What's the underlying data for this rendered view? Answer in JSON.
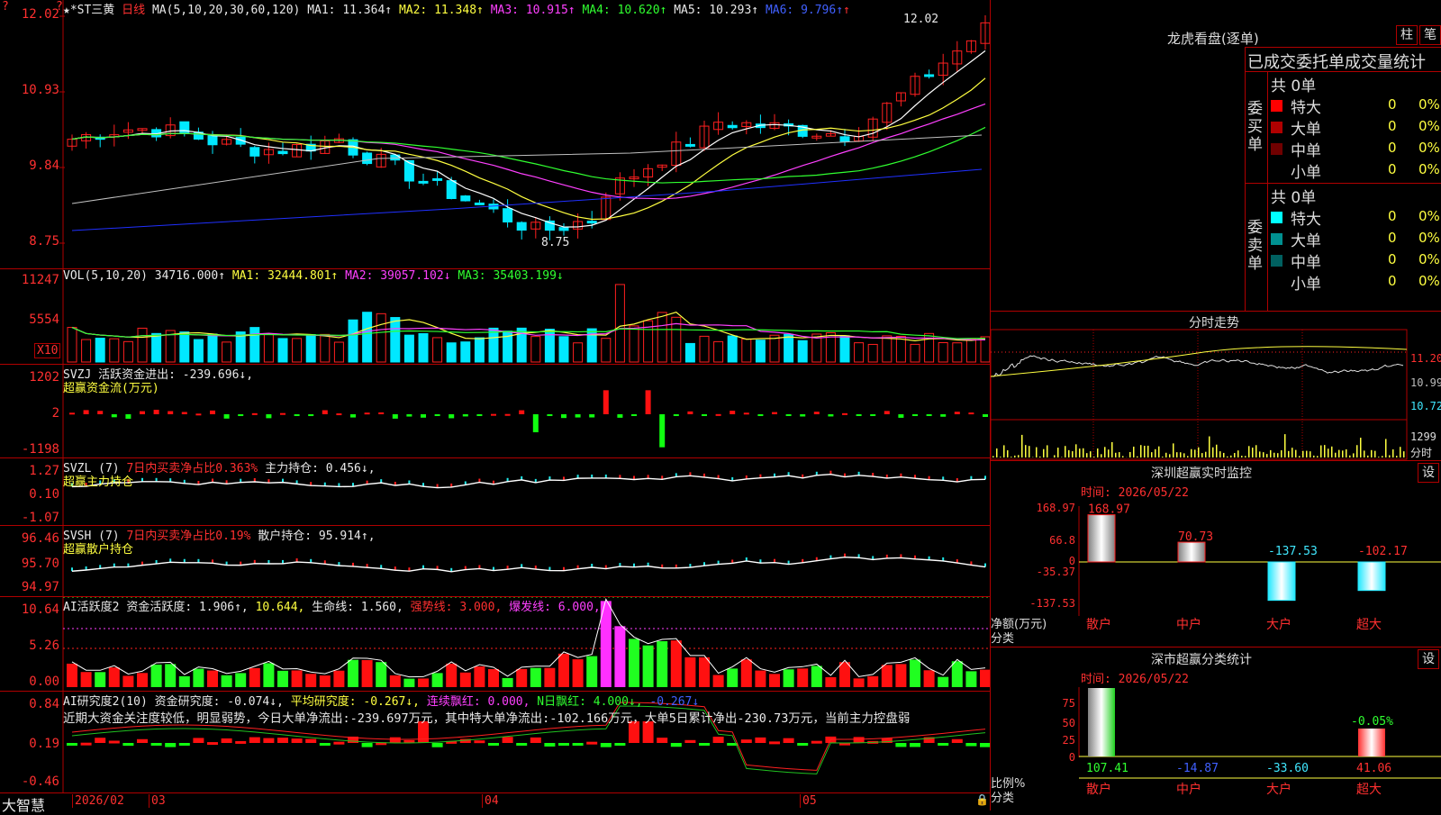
{
  "stock": {
    "name": "★*ST三黄",
    "period": "日线",
    "ma_header": {
      "label": "MA(5,10,20,30,60,120)",
      "ma1": "MA1: 11.364↑",
      "ma2": "MA2: 11.348↑",
      "ma3": "MA3: 10.915↑",
      "ma4": "MA4: 10.620↑",
      "ma5": "MA5: 10.293↑",
      "ma6": "MA6: 9.796↑"
    },
    "price_axis": [
      "12.02",
      "10.93",
      "9.84",
      "8.75"
    ],
    "high_label": "12.02",
    "low_label": "8.75"
  },
  "vol": {
    "header": {
      "label": "VOL(5,10,20)",
      "value": "34716.000↑",
      "ma1": "MA1: 32444.801↑",
      "ma2": "MA2: 39057.102↓",
      "ma3": "MA3: 35403.199↓"
    },
    "axis": [
      "11247",
      "5554"
    ],
    "unit": "X10"
  },
  "svzj": {
    "header": {
      "label": "SVZJ",
      "value": "活跃资金进出: -239.696↓,",
      "sub": "超赢资金流(万元)"
    },
    "axis": [
      "1202",
      "2",
      "-1198"
    ]
  },
  "svzl": {
    "header": {
      "label": "SVZL (7)",
      "ratio": "7日内买卖净占比0.363%",
      "value": "主力持仓: 0.456↓,",
      "sub": "超赢主力持仓"
    },
    "axis": [
      "1.27",
      "0.10",
      "-1.07"
    ]
  },
  "svsh": {
    "header": {
      "label": "SVSH (7)",
      "ratio": "7日内买卖净占比0.19%",
      "value": "散户持仓: 95.914↑,",
      "sub": "超赢散户持仓"
    },
    "axis": [
      "96.46",
      "95.70",
      "94.97"
    ]
  },
  "ai_active": {
    "header": {
      "label": "AI活跃度2",
      "v1": "资金活跃度: 1.906↑,",
      "v2": "10.644,",
      "v3": "生命线: 1.560,",
      "v4": "强势线: 3.000,",
      "v5": "爆发线: 6.000,"
    },
    "axis": [
      "10.64",
      "5.26",
      "0.00"
    ]
  },
  "ai_research": {
    "header": {
      "label": "AI研究度2(10)",
      "v1": "资金研究度: -0.074↓,",
      "v2": "平均研究度: -0.267↓,",
      "v3": "连续飘红: 0.000,",
      "v4": "N日飘红: 4.000↓,",
      "v5": "-0.267↓"
    },
    "comment": "近期大资金关注度较低，明显弱势，今日大单净流出:-239.697万元，其中特大单净流出:-102.166万元，大单5日累计净出-230.73万元，当前主力控盘弱",
    "axis": [
      "0.84",
      "0.19",
      "-0.46"
    ]
  },
  "timeline": {
    "brand": "大智慧",
    "labels": [
      "2026/02",
      "03",
      "04",
      "05"
    ]
  },
  "longhu": {
    "title": "龙虎看盘(逐单)",
    "btn_bar": "柱",
    "btn_tick": "笔",
    "tabs": [
      "已成交",
      "委托单",
      "成交量",
      "统计"
    ],
    "buy": {
      "side": "委买单",
      "total": "共 0单",
      "rows": [
        {
          "name": "特大",
          "count": "0",
          "pct": "0%",
          "color": "#ff0000"
        },
        {
          "name": "大单",
          "count": "0",
          "pct": "0%",
          "color": "#b00000"
        },
        {
          "name": "中单",
          "count": "0",
          "pct": "0%",
          "color": "#700000"
        },
        {
          "name": "小单",
          "count": "0",
          "pct": "0%",
          "color": "#000000"
        }
      ]
    },
    "sell": {
      "side": "委卖单",
      "total": "共 0单",
      "rows": [
        {
          "name": "特大",
          "count": "0",
          "pct": "0%",
          "color": "#00ffff"
        },
        {
          "name": "大单",
          "count": "0",
          "pct": "0%",
          "color": "#009090"
        },
        {
          "name": "中单",
          "count": "0",
          "pct": "0%",
          "color": "#006060"
        },
        {
          "name": "小单",
          "count": "0",
          "pct": "0%",
          "color": "#000000"
        }
      ]
    }
  },
  "intraday": {
    "title": "分时走势",
    "axis": [
      "11.20",
      "10.99",
      "10.72",
      "1299"
    ],
    "unit": "分时"
  },
  "sz_monitor": {
    "title": "深圳超赢实时监控",
    "btn": "设",
    "time": "时间: 2026/05/22",
    "axis": [
      "168.97",
      "66.8",
      "0",
      "-35.37",
      "-137.53"
    ],
    "ylabel": "净额(万元)",
    "xlabel": "分类",
    "categories": [
      "散户",
      "中户",
      "大户",
      "超大"
    ],
    "values": [
      168.97,
      70.73,
      -137.53,
      -102.17
    ],
    "value_labels": [
      "168.97",
      "70.73",
      "-137.53",
      "-102.17"
    ]
  },
  "sz_stats": {
    "title": "深市超赢分类统计",
    "btn": "设",
    "time": "时间: 2026/05/22",
    "axis": [
      "75",
      "50",
      "25",
      "0"
    ],
    "ylabel": "比例%",
    "xlabel": "分类",
    "categories": [
      "散户",
      "中户",
      "大户",
      "超大"
    ],
    "values": [
      107.41,
      -14.87,
      -33.6,
      41.06
    ],
    "value_labels": [
      "107.41",
      "-14.87",
      "-33.60",
      "41.06"
    ],
    "top_label": "-0.05%"
  }
}
